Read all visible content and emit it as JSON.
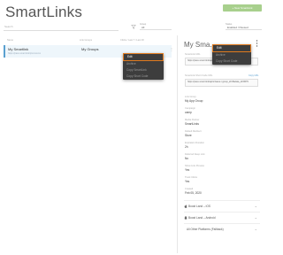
{
  "app": {
    "title": "SmartLinks",
    "create_label": "+ New SmartLink"
  },
  "toolbar": {
    "search_placeholder": "Search",
    "filters": [
      {
        "label": "Group",
        "value": "All"
      },
      {
        "label": "Status",
        "value": "Enabled / Paused"
      }
    ]
  },
  "table": {
    "headers": [
      "Name",
      "Link Groups",
      "Clicks / Last 7 / Last 30"
    ],
    "rows": [
      {
        "name": "My Smartlink",
        "subtitle": "https://pass.smart.link/p/xxxxxxxx",
        "group": "My Groups",
        "menu": "⋮"
      }
    ]
  },
  "row_menu": {
    "items": [
      "Edit",
      "Archive",
      "Copy SmartLink",
      "Copy Short Code"
    ]
  },
  "panel": {
    "title": "My Sma...",
    "menu_items": [
      "Edit",
      "Archive",
      "Copy Short Code"
    ],
    "fields": [
      {
        "label": "SmartLink URL",
        "value": "https://pass.smart.link/api/s/ group_id=8&data_id=..."
      },
      {
        "label": "SmartLink Short Code URL",
        "value": "https://pass.smart.link/api/s/Gaxw-i group_id=8&data_id=8679",
        "copy": "Copy URL"
      },
      {
        "label": "Link Group",
        "value": "My App Group"
      },
      {
        "label": "Campaign",
        "value": "camp"
      },
      {
        "label": "Media Partner",
        "value": "SmartLinks"
      },
      {
        "label": "Default Redirect",
        "value": "Store"
      },
      {
        "label": "Expiration Duration",
        "value": "2h"
      },
      {
        "label": "Deferred Deep Link",
        "value": "No"
      },
      {
        "label": "Show Link Preview",
        "value": "Yes"
      },
      {
        "label": "Track Clicks",
        "value": "Yes"
      },
      {
        "label": "Created",
        "value": "Feb 05, 2020"
      }
    ],
    "platforms": [
      {
        "icon": "apple-icon",
        "label": "Boost Land – iOS"
      },
      {
        "icon": "android-icon",
        "label": "Boost Land – Android"
      },
      {
        "icon": "globe-icon",
        "label": "All Other Platforms (Fallback)"
      }
    ]
  },
  "colors": {
    "highlight": "#e07b1f",
    "accent": "#5aa0d0",
    "create": "#a8d08d",
    "menu_bg": "#3d3d3d"
  }
}
